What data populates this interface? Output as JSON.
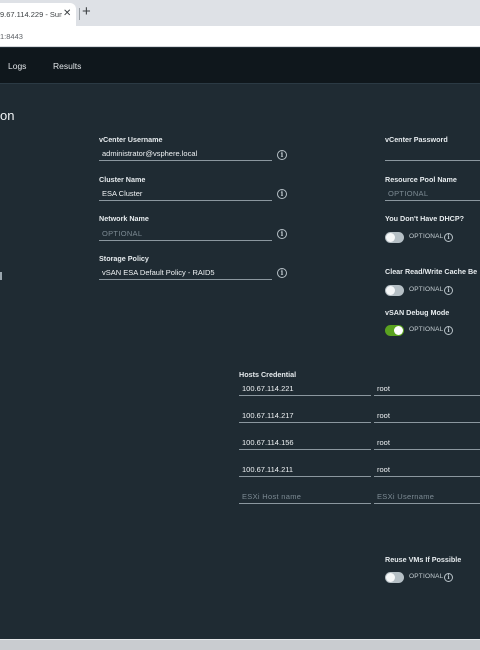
{
  "browser": {
    "tab_title": "9.67.114.229 - Sum",
    "tab_close": "✕",
    "new_tab": "+",
    "url": "1:8443"
  },
  "nav": {
    "logs": "Logs",
    "results": "Results"
  },
  "page": {
    "title": "on"
  },
  "form": {
    "vcenter_username": {
      "label": "vCenter Username",
      "value": "administrator@vsphere.local"
    },
    "vcenter_password": {
      "label": "vCenter Password",
      "value": ""
    },
    "cluster_name": {
      "label": "Cluster Name",
      "value": "ESA Cluster"
    },
    "resource_pool": {
      "label": "Resource Pool Name",
      "placeholder": "OPTIONAL"
    },
    "network_name": {
      "label": "Network Name",
      "placeholder": "OPTIONAL"
    },
    "no_dhcp": {
      "label": "You Don't Have DHCP?",
      "option": "OPTIONAL",
      "enabled": false
    },
    "storage_policy": {
      "label": "Storage Policy",
      "value": "vSAN ESA Default Policy - RAID5"
    },
    "clear_cache": {
      "label": "Clear Read/Write Cache Be",
      "option": "OPTIONAL",
      "enabled": false
    },
    "vsan_debug": {
      "label": "vSAN Debug Mode",
      "option": "OPTIONAL",
      "enabled": true
    },
    "reuse_vms": {
      "label": "Reuse VMs If Possible",
      "option": "OPTIONAL",
      "enabled": false
    }
  },
  "hosts": {
    "label": "Hosts Credential",
    "rows": [
      {
        "host": "100.67.114.221",
        "user": "root"
      },
      {
        "host": "100.67.114.217",
        "user": "root"
      },
      {
        "host": "100.67.114.156",
        "user": "root"
      },
      {
        "host": "100.67.114.211",
        "user": "root"
      }
    ],
    "host_placeholder": "ESXi Host name",
    "user_placeholder": "ESXi Username"
  },
  "icons": {
    "info": "i"
  },
  "colors": {
    "background": "#1f2b33",
    "header": "#0f171c",
    "toggle_on": "#5aa220"
  }
}
